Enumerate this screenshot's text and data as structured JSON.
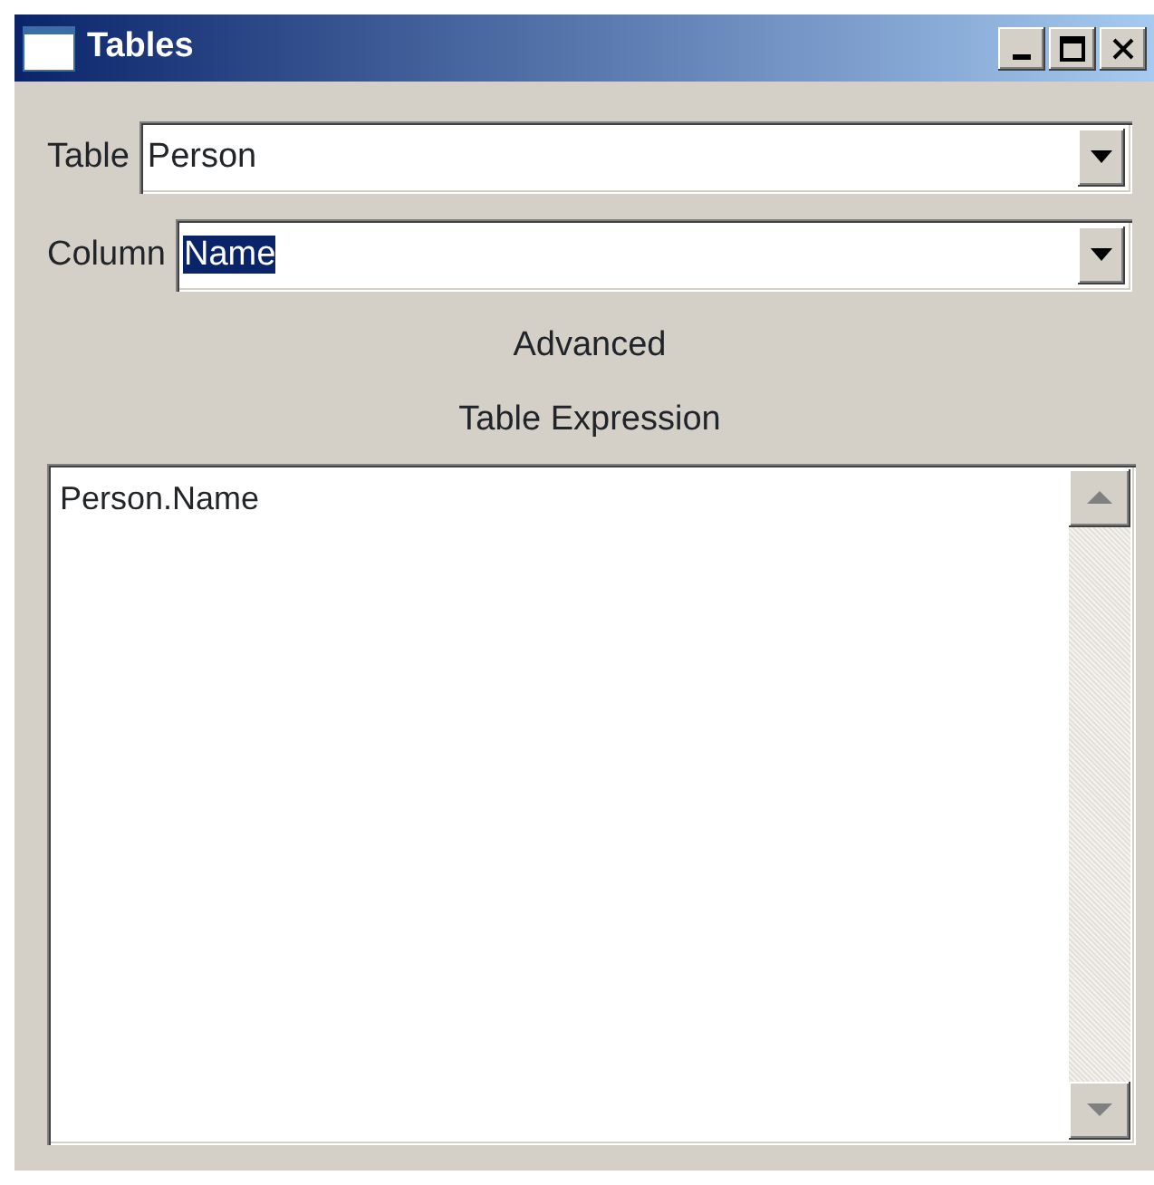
{
  "window": {
    "title": "Tables"
  },
  "fields": [
    {
      "label": "Table",
      "value": "Person",
      "highlighted": false
    },
    {
      "label": "Column",
      "value": "Name",
      "highlighted": true
    }
  ],
  "labels": [
    "Advanced",
    "Table Expression"
  ],
  "expression": {
    "text": "Person.Name"
  }
}
